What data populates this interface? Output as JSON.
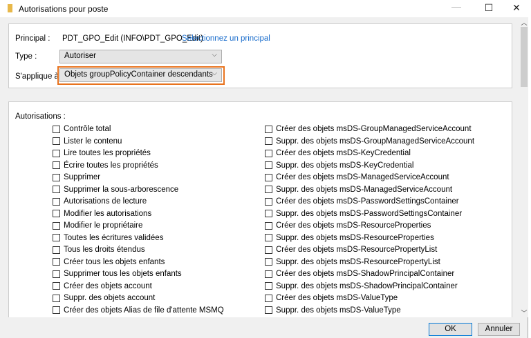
{
  "window": {
    "title": "Autorisations pour poste",
    "icon": "folder-icon",
    "controls": [
      "minimize-icon",
      "maximize-icon",
      "close-icon"
    ]
  },
  "principal": {
    "label": "Principal :",
    "value": "PDT_GPO_Edit (INFO\\PDT_GPO_Edit)",
    "link": "Sélectionnez un principal"
  },
  "type": {
    "label": "Type :",
    "value": "Autoriser"
  },
  "applies_to": {
    "label": "S'applique à :",
    "value": "Objets groupPolicyContainer descendants",
    "highlight_color": "#e8731e"
  },
  "permissions": {
    "label": "Autorisations :",
    "left": [
      "Contrôle total",
      "Lister le contenu",
      "Lire toutes les propriétés",
      "Écrire toutes les propriétés",
      "Supprimer",
      "Supprimer la sous-arborescence",
      "Autorisations de lecture",
      "Modifier les autorisations",
      "Modifier le propriétaire",
      "Toutes les écritures validées",
      "Tous les droits étendus",
      "Créer tous les objets enfants",
      "Supprimer tous les objets enfants",
      "Créer des objets account",
      "Suppr. des objets account",
      "Créer des objets Alias de file d'attente MSMQ"
    ],
    "right": [
      "Créer des objets msDS-GroupManagedServiceAccount",
      "Suppr. des objets msDS-GroupManagedServiceAccount",
      "Créer des objets msDS-KeyCredential",
      "Suppr. des objets msDS-KeyCredential",
      "Créer des objets msDS-ManagedServiceAccount",
      "Suppr. des objets msDS-ManagedServiceAccount",
      "Créer des objets msDS-PasswordSettingsContainer",
      "Suppr. des objets msDS-PasswordSettingsContainer",
      "Créer des objets msDS-ResourceProperties",
      "Suppr. des objets msDS-ResourceProperties",
      "Créer des objets msDS-ResourcePropertyList",
      "Suppr. des objets msDS-ResourcePropertyList",
      "Créer des objets msDS-ShadowPrincipalContainer",
      "Suppr. des objets msDS-ShadowPrincipalContainer",
      "Créer des objets msDS-ValueType",
      "Suppr. des objets msDS-ValueType"
    ]
  },
  "buttons": {
    "ok": "OK",
    "cancel": "Annuler"
  }
}
